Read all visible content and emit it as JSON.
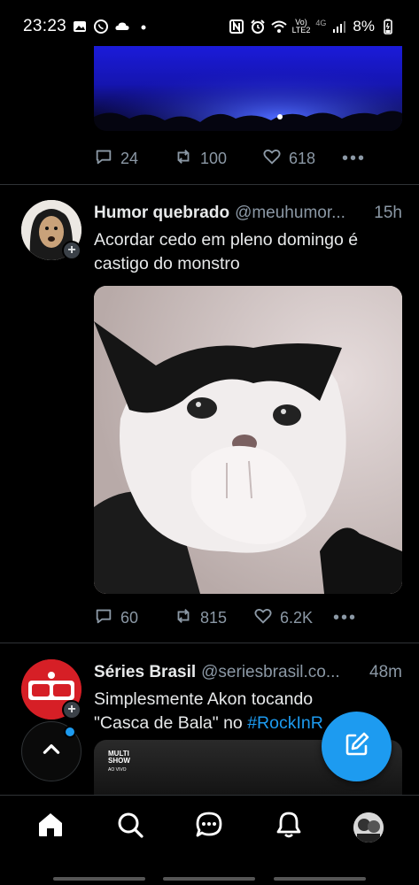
{
  "status_bar": {
    "time": "23:23",
    "network_vo": "Vo)",
    "network_lte": "LTE2",
    "network_4g": "4G",
    "battery": "8%"
  },
  "tweets": [
    {
      "reply_count": "24",
      "retweet_count": "100",
      "like_count": "618"
    },
    {
      "name": "Humor quebrado",
      "handle": "@meuhumor...",
      "time": "15h",
      "text": "Acordar cedo em pleno domingo é castigo do monstro",
      "reply_count": "60",
      "retweet_count": "815",
      "like_count": "6.2K"
    },
    {
      "name": "Séries Brasil",
      "handle": "@seriesbrasil.co...",
      "time": "48m",
      "text_line1": "Simplesmente Akon tocando",
      "text_line2_prefix": "\"Casca de Bala\" no ",
      "hashtag": "#RockInR",
      "thumb_brand_top": "MULTI",
      "thumb_brand_bottom": "SHOW",
      "thumb_sub": "AO VIVO"
    }
  ],
  "more_glyph": "•••",
  "plus_glyph": "+",
  "icons": {
    "reply": "reply-icon",
    "retweet": "retweet-icon",
    "like": "like-icon",
    "compose": "compose-icon",
    "scroll_top": "chevron-up-icon",
    "home": "home-icon",
    "search": "search-icon",
    "messages": "messages-icon",
    "notifications": "bell-icon"
  },
  "colors": {
    "accent": "#1d9bf0",
    "muted": "#8b98a5",
    "background": "#000000"
  }
}
